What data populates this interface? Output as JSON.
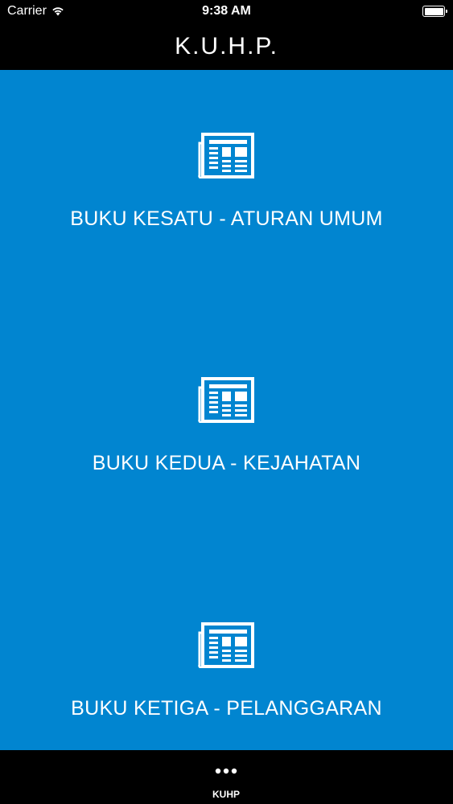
{
  "status_bar": {
    "carrier": "Carrier",
    "time": "9:38 AM"
  },
  "nav": {
    "title": "K.U.H.P."
  },
  "books": [
    {
      "label": "BUKU KESATU - ATURAN UMUM",
      "icon": "newspaper-icon"
    },
    {
      "label": "BUKU KEDUA - KEJAHATAN",
      "icon": "newspaper-icon"
    },
    {
      "label": "BUKU KETIGA - PELANGGARAN",
      "icon": "newspaper-icon"
    }
  ],
  "tab_bar": {
    "items": [
      {
        "label": "KUHP",
        "icon": "more-dots-icon"
      }
    ]
  },
  "colors": {
    "background": "#0185d0",
    "bars": "#000000",
    "text": "#ffffff"
  }
}
